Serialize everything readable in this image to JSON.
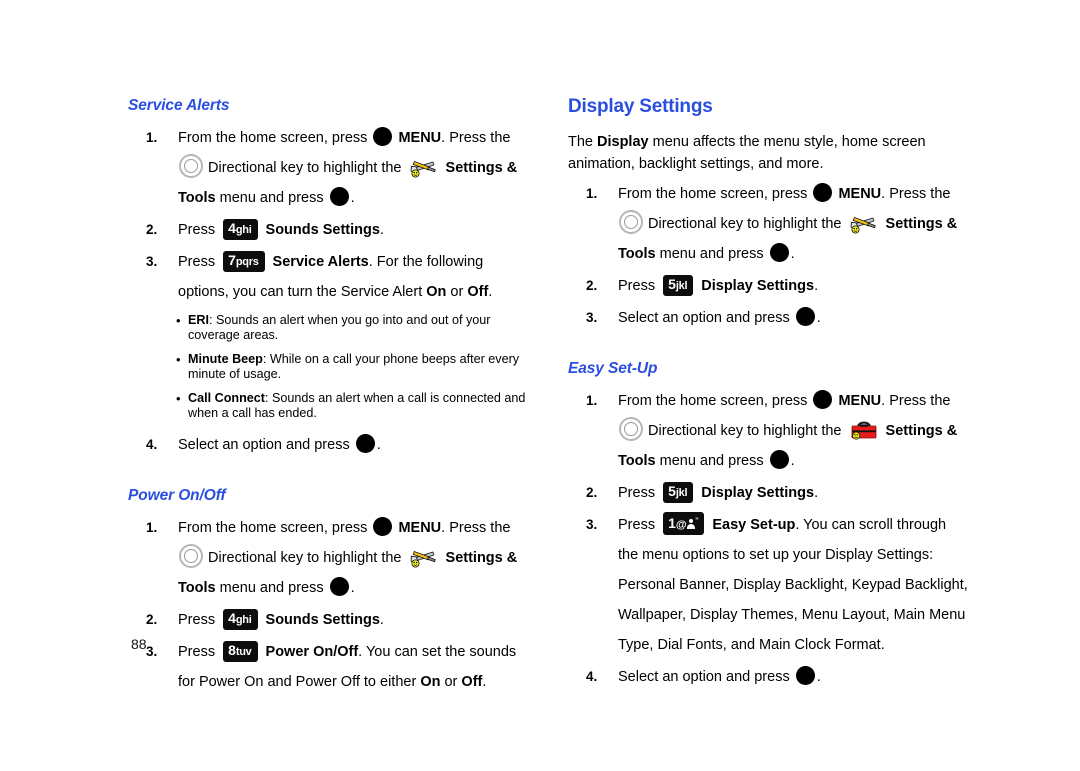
{
  "page": {
    "folio": "88",
    "heading_color": "#2a4fe0"
  },
  "left_column": {
    "sections": [
      {
        "id": "service-alerts",
        "heading": "Service Alerts",
        "heading_level": "h2",
        "steps": [
          {
            "num": "1.",
            "parts": [
              {
                "t": "text",
                "v": "From the home screen, press "
              },
              {
                "t": "icon",
                "v": "ok-key-icon"
              },
              {
                "t": "bold",
                "v": " MENU"
              },
              {
                "t": "text",
                "v": ". Press the "
              },
              {
                "t": "icon",
                "v": "directional-key-icon"
              },
              {
                "t": "text",
                "v": " Directional key to highlight the "
              },
              {
                "t": "icon",
                "v": "settings-tools-icon"
              },
              {
                "t": "bold",
                "v": " Settings & Tools"
              },
              {
                "t": "text",
                "v": " menu and press "
              },
              {
                "t": "icon",
                "v": "ok-key-icon"
              },
              {
                "t": "text",
                "v": "."
              }
            ]
          },
          {
            "num": "2.",
            "parts": [
              {
                "t": "text",
                "v": "Press "
              },
              {
                "t": "key",
                "num": "4",
                "letters": "ghi"
              },
              {
                "t": "bold",
                "v": " Sounds Settings"
              },
              {
                "t": "text",
                "v": "."
              }
            ]
          },
          {
            "num": "3.",
            "parts": [
              {
                "t": "text",
                "v": "Press "
              },
              {
                "t": "key",
                "num": "7",
                "letters": "pqrs"
              },
              {
                "t": "bold",
                "v": " Service Alerts"
              },
              {
                "t": "text",
                "v": ". For the following options, you can turn the Service Alert "
              },
              {
                "t": "bold",
                "v": "On"
              },
              {
                "t": "text",
                "v": " or "
              },
              {
                "t": "bold",
                "v": "Off"
              },
              {
                "t": "text",
                "v": "."
              }
            ]
          }
        ],
        "bullets": [
          {
            "term": "ERI",
            "body": ": Sounds an alert when you go into and out of your coverage areas."
          },
          {
            "term": "Minute Beep",
            "body": ": While on a call your phone beeps after every minute of usage."
          },
          {
            "term": "Call Connect",
            "body": ": Sounds an alert when a call is connected and when a call has ended."
          }
        ],
        "steps_after": [
          {
            "num": "4.",
            "parts": [
              {
                "t": "text",
                "v": "Select an option and press "
              },
              {
                "t": "icon",
                "v": "ok-key-icon"
              },
              {
                "t": "text",
                "v": "."
              }
            ]
          }
        ]
      },
      {
        "id": "power-on-off",
        "heading": "Power On/Off",
        "heading_level": "h2",
        "steps": [
          {
            "num": "1.",
            "parts": [
              {
                "t": "text",
                "v": "From the home screen, press "
              },
              {
                "t": "icon",
                "v": "ok-key-icon"
              },
              {
                "t": "bold",
                "v": " MENU"
              },
              {
                "t": "text",
                "v": ". Press the "
              },
              {
                "t": "icon",
                "v": "directional-key-icon"
              },
              {
                "t": "text",
                "v": " Directional key to highlight the "
              },
              {
                "t": "icon",
                "v": "settings-tools-icon"
              },
              {
                "t": "bold",
                "v": " Settings & Tools"
              },
              {
                "t": "text",
                "v": " menu and press "
              },
              {
                "t": "icon",
                "v": "ok-key-icon"
              },
              {
                "t": "text",
                "v": "."
              }
            ]
          },
          {
            "num": "2.",
            "parts": [
              {
                "t": "text",
                "v": "Press "
              },
              {
                "t": "key",
                "num": "4",
                "letters": "ghi"
              },
              {
                "t": "bold",
                "v": " Sounds Settings"
              },
              {
                "t": "text",
                "v": "."
              }
            ]
          },
          {
            "num": "3.",
            "parts": [
              {
                "t": "text",
                "v": "Press "
              },
              {
                "t": "key",
                "num": "8",
                "letters": "tuv"
              },
              {
                "t": "bold",
                "v": " Power On/Off"
              },
              {
                "t": "text",
                "v": ". You can set the sounds for Power On and Power Off to either "
              },
              {
                "t": "bold",
                "v": "On"
              },
              {
                "t": "text",
                "v": " or "
              },
              {
                "t": "bold",
                "v": "Off"
              },
              {
                "t": "text",
                "v": "."
              }
            ]
          }
        ]
      }
    ]
  },
  "right_column": {
    "sections": [
      {
        "id": "display-settings",
        "heading": "Display Settings",
        "heading_level": "h1",
        "intro": [
          {
            "t": "text",
            "v": "The "
          },
          {
            "t": "bold",
            "v": "Display"
          },
          {
            "t": "text",
            "v": " menu affects the menu style, home screen animation, backlight settings, and more."
          }
        ],
        "steps": [
          {
            "num": "1.",
            "parts": [
              {
                "t": "text",
                "v": "From the home screen, press "
              },
              {
                "t": "icon",
                "v": "ok-key-icon"
              },
              {
                "t": "bold",
                "v": " MENU"
              },
              {
                "t": "text",
                "v": ". Press the "
              },
              {
                "t": "icon",
                "v": "directional-key-icon"
              },
              {
                "t": "text",
                "v": " Directional key to highlight the "
              },
              {
                "t": "icon",
                "v": "settings-tools-icon"
              },
              {
                "t": "bold",
                "v": " Settings & Tools"
              },
              {
                "t": "text",
                "v": " menu and press "
              },
              {
                "t": "icon",
                "v": "ok-key-icon"
              },
              {
                "t": "text",
                "v": "."
              }
            ]
          },
          {
            "num": "2.",
            "parts": [
              {
                "t": "text",
                "v": "Press "
              },
              {
                "t": "key",
                "num": "5",
                "letters": "jkl"
              },
              {
                "t": "bold",
                "v": " Display Settings"
              },
              {
                "t": "text",
                "v": "."
              }
            ]
          },
          {
            "num": "3.",
            "parts": [
              {
                "t": "text",
                "v": "Select an option and press "
              },
              {
                "t": "icon",
                "v": "ok-key-icon"
              },
              {
                "t": "text",
                "v": "."
              }
            ]
          }
        ]
      },
      {
        "id": "easy-set-up",
        "heading": "Easy Set-Up",
        "heading_level": "h2",
        "steps": [
          {
            "num": "1.",
            "parts": [
              {
                "t": "text",
                "v": "From the home screen, press "
              },
              {
                "t": "icon",
                "v": "ok-key-icon"
              },
              {
                "t": "bold",
                "v": " MENU"
              },
              {
                "t": "text",
                "v": ". Press the "
              },
              {
                "t": "icon",
                "v": "directional-key-icon"
              },
              {
                "t": "text",
                "v": " Directional key to highlight the "
              },
              {
                "t": "icon",
                "v": "toolbox-icon"
              },
              {
                "t": "bold",
                "v": " Settings & Tools"
              },
              {
                "t": "text",
                "v": " menu and press "
              },
              {
                "t": "icon",
                "v": "ok-key-icon"
              },
              {
                "t": "text",
                "v": "."
              }
            ]
          },
          {
            "num": "2.",
            "parts": [
              {
                "t": "text",
                "v": "Press "
              },
              {
                "t": "key",
                "num": "5",
                "letters": "jkl"
              },
              {
                "t": "bold",
                "v": " Display Settings"
              },
              {
                "t": "text",
                "v": "."
              }
            ]
          },
          {
            "num": "3.",
            "parts": [
              {
                "t": "text",
                "v": "Press "
              },
              {
                "t": "key",
                "num": "1",
                "letters": "@person"
              },
              {
                "t": "bold",
                "v": " Easy Set-up"
              },
              {
                "t": "text",
                "v": ". You can scroll through the menu options to set up your Display Settings: Personal Banner, Display Backlight, Keypad Backlight, Wallpaper, Display Themes, Menu Layout, Main Menu Type, Dial Fonts, and Main Clock Format."
              }
            ]
          },
          {
            "num": "4.",
            "parts": [
              {
                "t": "text",
                "v": "Select an option and press "
              },
              {
                "t": "icon",
                "v": "ok-key-icon"
              },
              {
                "t": "text",
                "v": "."
              }
            ]
          }
        ]
      }
    ]
  }
}
